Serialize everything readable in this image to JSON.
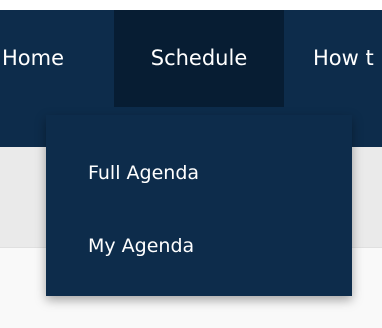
{
  "nav": {
    "items": [
      {
        "label": "Home"
      },
      {
        "label": "Schedule",
        "active": true
      },
      {
        "label": "How t"
      }
    ]
  },
  "dropdown": {
    "items": [
      {
        "label": "Full Agenda"
      },
      {
        "label": "My Agenda"
      }
    ]
  },
  "colors": {
    "nav_bg": "#0d2c4b",
    "nav_active_bg": "#071d33",
    "subbar_bg": "#eaeaea",
    "page_bg": "#f9f9f9",
    "text": "#ffffff"
  }
}
